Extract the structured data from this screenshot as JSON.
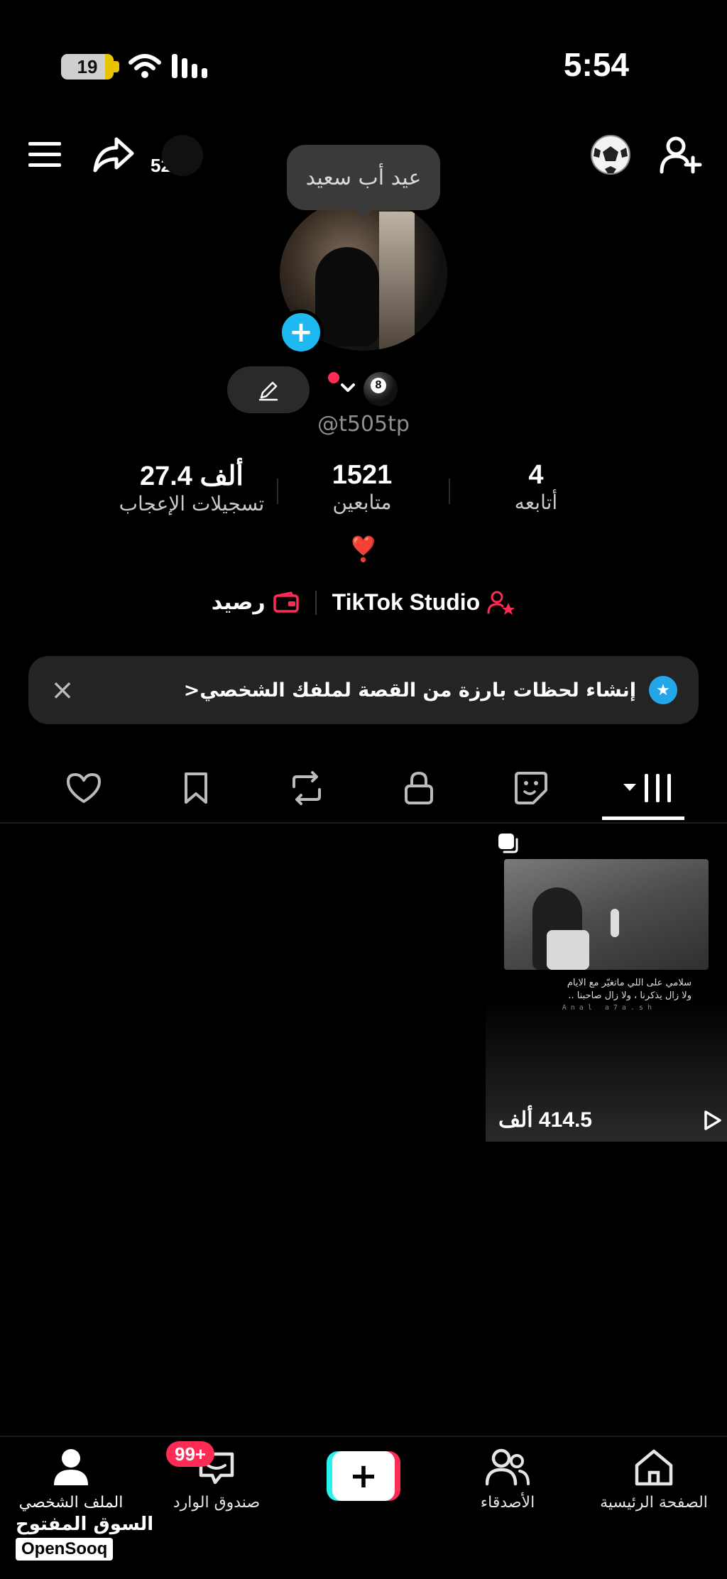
{
  "status_bar": {
    "battery": "19",
    "time": "5:54"
  },
  "header": {
    "share_count": "52",
    "tooltip": "عيد أب سعيد"
  },
  "profile": {
    "username": "@t505tp",
    "bio_emoji": "❣️"
  },
  "stats": [
    {
      "value": "27.4 ألف",
      "label": "تسجيلات الإعجاب"
    },
    {
      "value": "1521",
      "label": "متابعين"
    },
    {
      "value": "4",
      "label": "أتابعه"
    }
  ],
  "links": {
    "studio": "TikTok Studio",
    "balance": "رصيد"
  },
  "banner": {
    "text": "إنشاء لحظات بارزة من القصة لملفك الشخصي<"
  },
  "video": {
    "caption_line1": "سلامي على اللي ماتغيّر مع الايام",
    "caption_line2": "ولا زال يذكرنا ، ولا زال صاحبنا ..",
    "watermark": "Anal a7a.sh",
    "views": "414.5 ألف"
  },
  "bottom_nav": {
    "home": "الصفحة الرئيسية",
    "friends": "الأصدقاء",
    "inbox": "صندوق الوارد",
    "inbox_badge": "99+",
    "profile": "الملف الشخصي",
    "create": "+"
  },
  "watermark": {
    "arabic": "السوق المفتوح",
    "latin": "OpenSooq"
  },
  "colors": {
    "accent_red": "#fe2c55",
    "accent_cyan": "#25f4ee",
    "blue": "#1db9f0"
  }
}
